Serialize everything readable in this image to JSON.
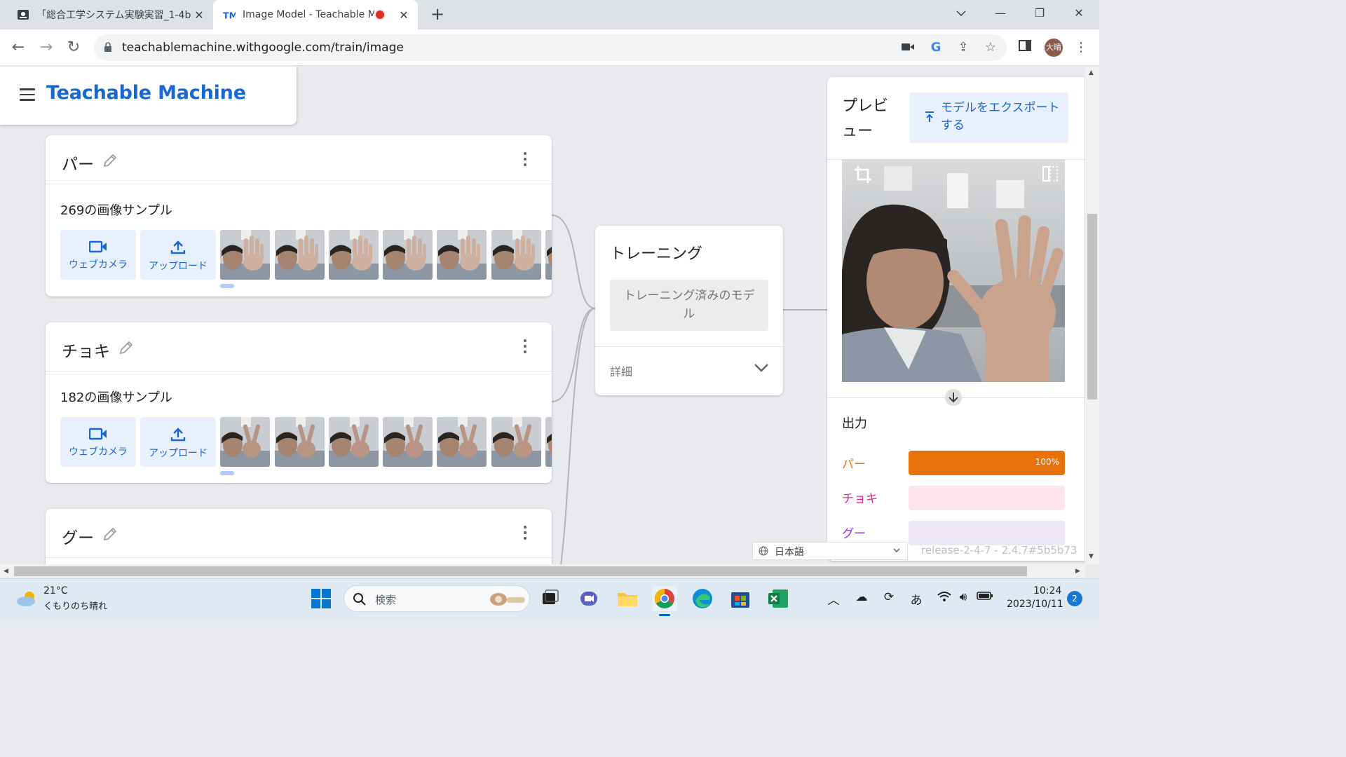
{
  "browser": {
    "tabs": [
      {
        "title": "「総合工学システム実験実習_1-4b",
        "active": false
      },
      {
        "title": "Image Model - Teachable Machine",
        "favicon": "TM",
        "active": true,
        "recording": true
      }
    ],
    "url": "teachablemachine.withgoogle.com/train/image",
    "profile_initials": "大晴"
  },
  "app": {
    "brand": "Teachable Machine",
    "classes": [
      {
        "name": "パー",
        "sample_count": "269の画像サンプル",
        "webcam_label": "ウェブカメラ",
        "upload_label": "アップロード",
        "gesture": "palm"
      },
      {
        "name": "チョキ",
        "sample_count": "182の画像サンプル",
        "webcam_label": "ウェブカメラ",
        "upload_label": "アップロード",
        "gesture": "peace"
      },
      {
        "name": "グー"
      }
    ],
    "training": {
      "title": "トレーニング",
      "button_label": "トレーニング済みのモデル",
      "details_label": "詳細"
    },
    "preview": {
      "title": "プレビュー",
      "export_label": "モデルをエクスポートする",
      "output_label": "出力",
      "outputs": [
        {
          "label": "パー",
          "value": 1.0,
          "value_text": "100%",
          "color": "#e8710a",
          "track": "#fdd9b5"
        },
        {
          "label": "チョキ",
          "value": 0.0,
          "value_text": "",
          "color": "#e52592",
          "track": "#fde4ea"
        },
        {
          "label": "グー",
          "value": 0.0,
          "value_text": "",
          "color": "#9334e6",
          "track": "#ede7f6"
        }
      ]
    },
    "language": "日本語",
    "release": "release-2-4-7 - 2.4.7#5b5b73"
  },
  "taskbar": {
    "weather_temp": "21°C",
    "weather_desc": "くもりのち晴れ",
    "search_placeholder": "検索",
    "time": "10:24",
    "date": "2023/10/11",
    "notifications": "2",
    "ime": "あ"
  }
}
